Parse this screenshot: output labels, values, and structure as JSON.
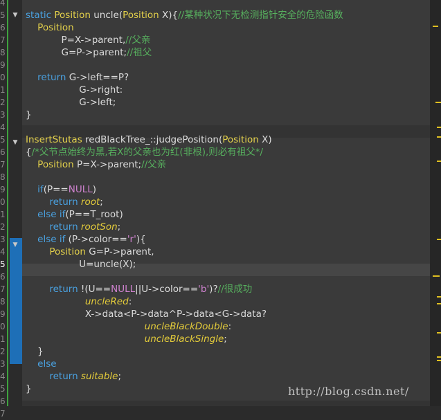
{
  "gutter": {
    "line_numbers": [
      "4",
      "5",
      "6",
      "7",
      "8",
      "9",
      "0",
      "1",
      "2",
      "3",
      "4",
      "5",
      "6",
      "7",
      "8",
      "9",
      "0",
      "1",
      "2",
      "3",
      "4",
      "5",
      "6",
      "7",
      "8",
      "9",
      "0",
      "1",
      "2",
      "3",
      "4",
      "5",
      "6",
      "7"
    ],
    "current_line": "4"
  },
  "code_lines": [
    [
      [
        "k",
        "static"
      ],
      [
        "w",
        " "
      ],
      [
        "t",
        "Position"
      ],
      [
        "w",
        " uncle("
      ],
      [
        "t",
        "Position"
      ],
      [
        "w",
        " X){"
      ],
      [
        "c",
        "//某种状况下无检测指针安全的危险函数"
      ]
    ],
    [
      [
        "w",
        "    "
      ],
      [
        "t",
        "Position"
      ]
    ],
    [
      [
        "w",
        "            P=X->parent,"
      ],
      [
        "c",
        "//父亲"
      ]
    ],
    [
      [
        "w",
        "            G=P->parent;"
      ],
      [
        "c",
        "//祖父"
      ]
    ],
    [],
    [
      [
        "w",
        "    "
      ],
      [
        "k",
        "return"
      ],
      [
        "w",
        " G->left==P?"
      ]
    ],
    [
      [
        "w",
        "                  G->right:"
      ]
    ],
    [
      [
        "w",
        "                  G->left;"
      ]
    ],
    [
      [
        "w",
        "}"
      ]
    ],
    [],
    [
      [
        "t",
        "InsertStutas"
      ],
      [
        "w",
        " redBlackTree_::judgePosition("
      ],
      [
        "t",
        "Position"
      ],
      [
        "w",
        " X)"
      ]
    ],
    [
      [
        "w",
        "{"
      ],
      [
        "c",
        "/*父节点始终为黑,若X的父亲也为红(非根),则必有祖父*/"
      ]
    ],
    [
      [
        "w",
        "    "
      ],
      [
        "t",
        "Position"
      ],
      [
        "w",
        " P=X->parent;"
      ],
      [
        "c",
        "//父亲"
      ]
    ],
    [],
    [
      [
        "w",
        "    "
      ],
      [
        "k",
        "if"
      ],
      [
        "w",
        "(P=="
      ],
      [
        "s",
        "NULL"
      ],
      [
        "w",
        ")"
      ]
    ],
    [
      [
        "w",
        "        "
      ],
      [
        "k",
        "return"
      ],
      [
        "w",
        " "
      ],
      [
        "i",
        "root"
      ],
      [
        "w",
        ";"
      ]
    ],
    [
      [
        "w",
        "    "
      ],
      [
        "k",
        "else if"
      ],
      [
        "w",
        "(P==T_root)"
      ]
    ],
    [
      [
        "w",
        "        "
      ],
      [
        "k",
        "return"
      ],
      [
        "w",
        " "
      ],
      [
        "i",
        "rootSon"
      ],
      [
        "w",
        ";"
      ]
    ],
    [
      [
        "w",
        "    "
      ],
      [
        "k",
        "else if"
      ],
      [
        "w",
        " (P->color=="
      ],
      [
        "s",
        "'r'"
      ],
      [
        "w",
        "){"
      ]
    ],
    [
      [
        "w",
        "        "
      ],
      [
        "t",
        "Position"
      ],
      [
        "w",
        " G=P->parent,"
      ]
    ],
    [
      [
        "w",
        "                  U=uncle(X);"
      ]
    ],
    [],
    [
      [
        "w",
        "        "
      ],
      [
        "k",
        "return"
      ],
      [
        "w",
        " !(U=="
      ],
      [
        "s",
        "NULL"
      ],
      [
        "w",
        "||U->color=="
      ],
      [
        "s",
        "'b'"
      ],
      [
        "w",
        ")?"
      ],
      [
        "c",
        "//很成功"
      ]
    ],
    [
      [
        "w",
        "                    "
      ],
      [
        "i",
        "uncleRed"
      ],
      [
        "w",
        ":"
      ]
    ],
    [
      [
        "w",
        "                    X->data<P->data^P->data<G->data?"
      ]
    ],
    [
      [
        "w",
        "                                        "
      ],
      [
        "i",
        "uncleBlackDouble"
      ],
      [
        "w",
        ":"
      ]
    ],
    [
      [
        "w",
        "                                        "
      ],
      [
        "i",
        "uncleBlackSingle"
      ],
      [
        "w",
        ";"
      ]
    ],
    [
      [
        "w",
        "    }"
      ]
    ],
    [
      [
        "w",
        "    "
      ],
      [
        "k",
        "else"
      ]
    ],
    [
      [
        "w",
        "        "
      ],
      [
        "k",
        "return"
      ],
      [
        "w",
        " "
      ],
      [
        "i",
        "suitable"
      ],
      [
        "w",
        ";"
      ]
    ],
    [
      [
        "w",
        "}"
      ]
    ]
  ],
  "watermark": "http://blog.csdn.net/",
  "colors": {
    "background": "#333333",
    "keyword": "#4aa1e0",
    "type": "#e3d04b",
    "comment": "#57b05e",
    "literal": "#cf82cf",
    "enum_italic": "#e4cc3a",
    "text": "#dcdcdc",
    "changed_marker": "#3ea33e",
    "selection_marker": "#1e6fb7"
  }
}
